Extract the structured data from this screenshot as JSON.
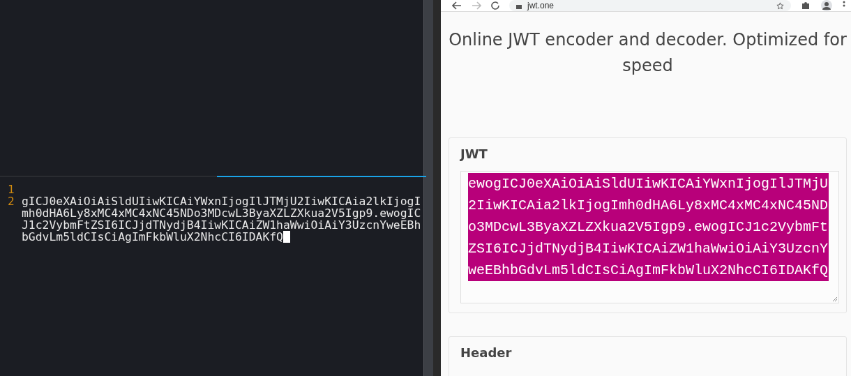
{
  "terminal": {
    "lines": [
      {
        "number": "1"
      },
      {
        "number": "2",
        "text": "gICJ0eXAiOiAiSldUIiwKICAiYWxnIjogIlJTMjU2IiwKICAia2lkIjogImh0dHA6Ly8xMC4xMC4xNC45NDo3MDcwL3ByaXZLZXkua2V5Igp9.ewogICJ1c2VybmFtZSI6ICJjdTNydjB4IiwKICAiZW1haWwiOiAiY3UzcnYweEBhbGdvLm5ldCIsCiAgImFkbWluX2NhcCI6IDAKfQ",
        "cursor": true
      }
    ]
  },
  "browser": {
    "url": "jwt.one",
    "heading": "Online JWT encoder and decoder. Optimized for speed",
    "jwt_card": {
      "title": "JWT",
      "value": "ewogICJ0eXAiOiAiSldUIiwKICAiYWxnIjogIlJTMjU2IiwKICAia2lkIjogImh0dHA6Ly8xMC4xMC4xNC45NDo3MDcwL3ByaXZLZXkua2V5Igp9.ewogICJ1c2VybmFtZSI6ICJjdTNydjB4IiwKICAiZW1haWwiOiAiY3UzcnYweEBhbGdvLm5ldCIsCiAgImFkbWluX2NhcCI6IDAKfQ",
      "selected": true
    },
    "header_card": {
      "title": "Header"
    }
  }
}
